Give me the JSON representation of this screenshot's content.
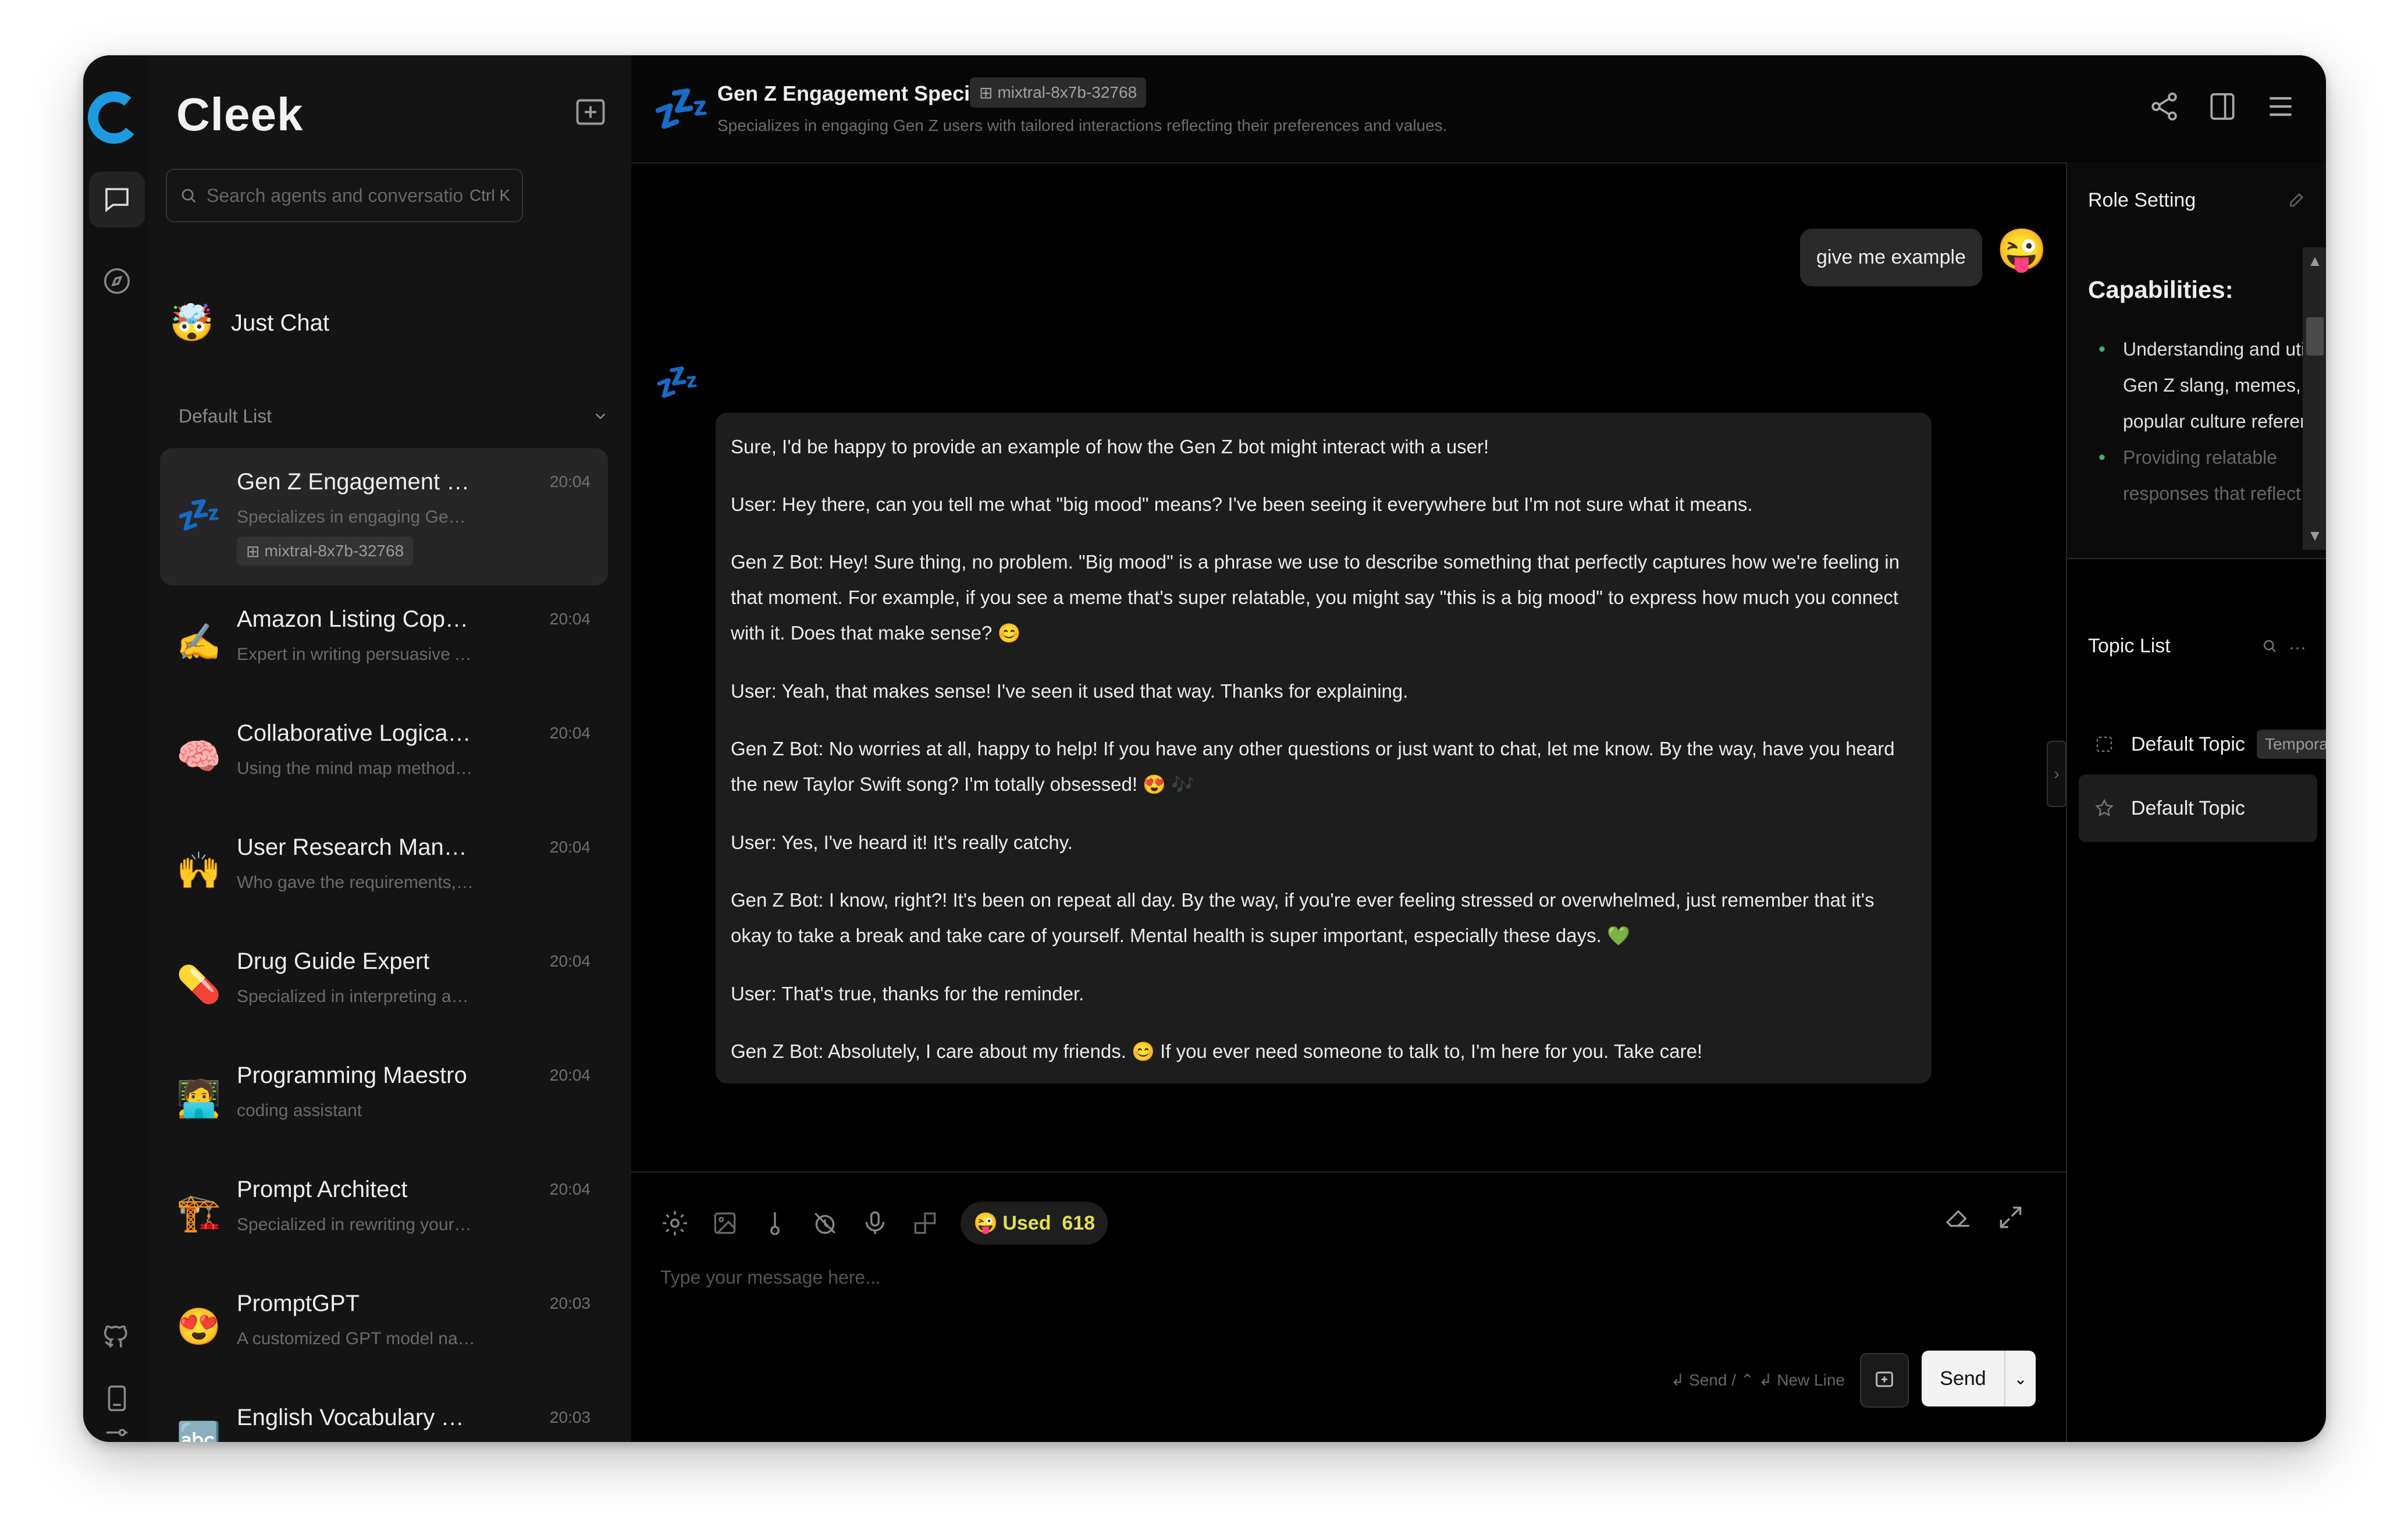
{
  "app": {
    "brand": "Cleek",
    "search": {
      "placeholder": "Search agents and conversatio",
      "shortcut": "Ctrl K"
    }
  },
  "sidebar": {
    "just_chat": "Just Chat",
    "group_label": "Default List",
    "agents": [
      {
        "name": "Gen Z Engagement Sp...",
        "time": "20:04",
        "desc": "Specializes in engaging Gen Z u...",
        "tag": "mixtral-8x7b-32768",
        "selected": true,
        "icon": "sleeping-zzz"
      },
      {
        "name": "Amazon Listing Copyw...",
        "time": "20:04",
        "desc": "Expert in writing persuasive Am...",
        "icon": "writing-hand"
      },
      {
        "name": "Collaborative Logical T...",
        "time": "20:04",
        "desc": "Using the mind map method, th...",
        "icon": "brain"
      },
      {
        "name": "User Research Manage...",
        "time": "20:04",
        "desc": "Who gave the requirements, let ...",
        "icon": "person-raising-hands"
      },
      {
        "name": "Drug Guide Expert",
        "time": "20:04",
        "desc": "Specialized in interpreting and ...",
        "icon": "pill"
      },
      {
        "name": "Programming Maestro",
        "time": "20:04",
        "desc": "coding assistant",
        "icon": "technologist"
      },
      {
        "name": "Prompt Architect",
        "time": "20:04",
        "desc": "Specialized in rewriting your pr...",
        "icon": "construction-crane"
      },
      {
        "name": "PromptGPT",
        "time": "20:03",
        "desc": "A customized GPT model name...",
        "icon": "heart-eyes"
      },
      {
        "name": "English Vocabulary Tea...",
        "time": "20:03",
        "desc": "",
        "icon": "letters"
      }
    ]
  },
  "header": {
    "title": "Gen Z Engagement Specialist",
    "model": "mixtral-8x7b-32768",
    "description": "Specializes in engaging Gen Z users with tailored interactions reflecting their preferences and values."
  },
  "chat": {
    "user_message": "give me example",
    "bot_paragraphs": [
      "Sure, I'd be happy to provide an example of how the Gen Z bot might interact with a user!",
      "User: Hey there, can you tell me what \"big mood\" means? I've been seeing it everywhere but I'm not sure what it means.",
      "Gen Z Bot: Hey! Sure thing, no problem. \"Big mood\" is a phrase we use to describe something that perfectly captures how we're feeling in that moment. For example, if you see a meme that's super relatable, you might say \"this is a big mood\" to express how much you connect with it. Does that make sense?",
      "User: Yeah, that makes sense! I've seen it used that way. Thanks for explaining.",
      "Gen Z Bot: No worries at all, happy to help! If you have any other questions or just want to chat, let me know. By the way, have you heard the new Taylor Swift song? I'm totally obsessed!",
      "User: Yes, I've heard it! It's really catchy.",
      "Gen Z Bot: I know, right?! It's been on repeat all day. By the way, if you're ever feeling stressed or overwhelmed, just remember that it's okay to take a break and take care of yourself. Mental health is super important, especially these days.",
      "User: That's true, thanks for the reminder.",
      "Gen Z Bot: Absolutely, I care about my friends."
    ],
    "last_tail": "If you ever need someone to talk to, I'm here for you. Take care!",
    "emojis": {
      "p3": "😊",
      "p5": "😍",
      "p5b": "🎶",
      "p7": "💚",
      "p9": "😊"
    }
  },
  "input": {
    "used_label": "Used",
    "used_count": "618",
    "placeholder": "Type your message here...",
    "hint": "↲ Send / ⌃ ↲ New Line",
    "send_label": "Send"
  },
  "role_panel": {
    "title": "Role Setting",
    "capabilities_title": "Capabilities:",
    "capabilities": [
      "Understanding and utilizing Gen Z slang, memes, and popular culture references.",
      "Providing relatable responses that reflect"
    ]
  },
  "topics": {
    "title": "Topic List",
    "items": [
      {
        "label": "Default Topic",
        "tag": "Temporary"
      },
      {
        "label": "Default Topic",
        "tag": ""
      }
    ]
  },
  "colors": {
    "background": "#000000",
    "accent_green": "#3fb36b",
    "used_yellow": "#e4e04d",
    "logo_blue": "#1e9be0"
  }
}
